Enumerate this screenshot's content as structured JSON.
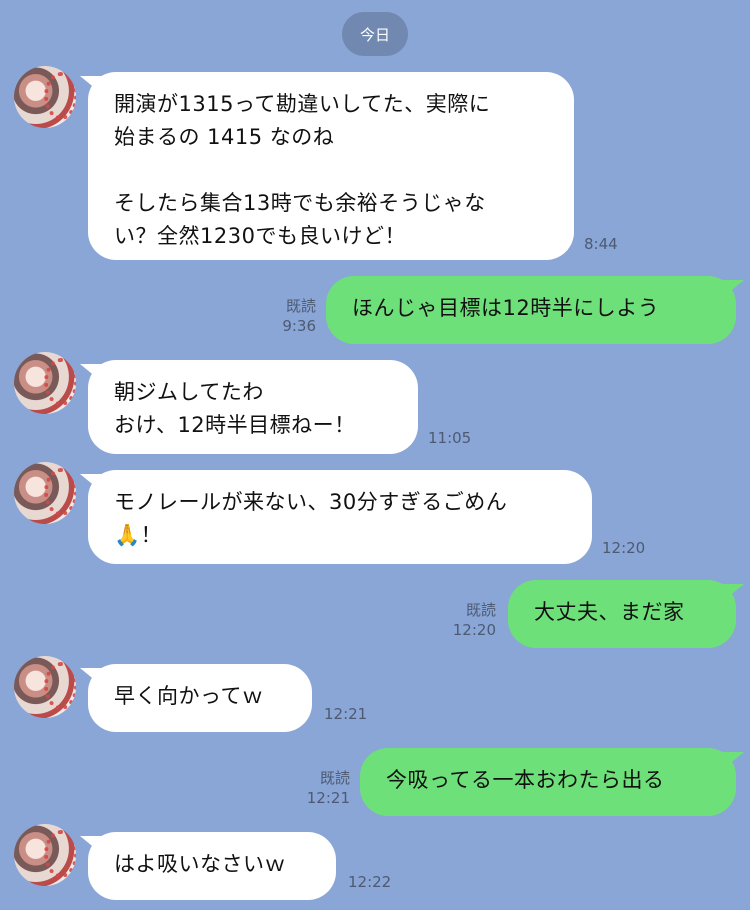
{
  "date_label": "今日",
  "read_label": "既読",
  "messages": [
    {
      "side": "in",
      "text": "開演が1315って勘違いしてた、実際に\n始まるの 1415 なのね\n\nそしたら集合13時でも余裕そうじゃな\nい？全然1230でも良いけど！",
      "time": "8:44"
    },
    {
      "side": "out",
      "text": "ほんじゃ目標は12時半にしよう",
      "time": "9:36",
      "read": true
    },
    {
      "side": "in",
      "text": "朝ジムしてたわ\nおけ、12時半目標ねー！",
      "time": "11:05"
    },
    {
      "side": "in",
      "text": "モノレールが来ない、30分すぎるごめん\n🙏！",
      "time": "12:20"
    },
    {
      "side": "out",
      "text": "大丈夫、まだ家",
      "time": "12:20",
      "read": true
    },
    {
      "side": "in",
      "text": "早く向かってｗ",
      "time": "12:21"
    },
    {
      "side": "out",
      "text": "今吸ってる一本おわたら出る",
      "time": "12:21",
      "read": true
    },
    {
      "side": "in",
      "text": "はよ吸いなさいｗ",
      "time": "12:22"
    }
  ]
}
